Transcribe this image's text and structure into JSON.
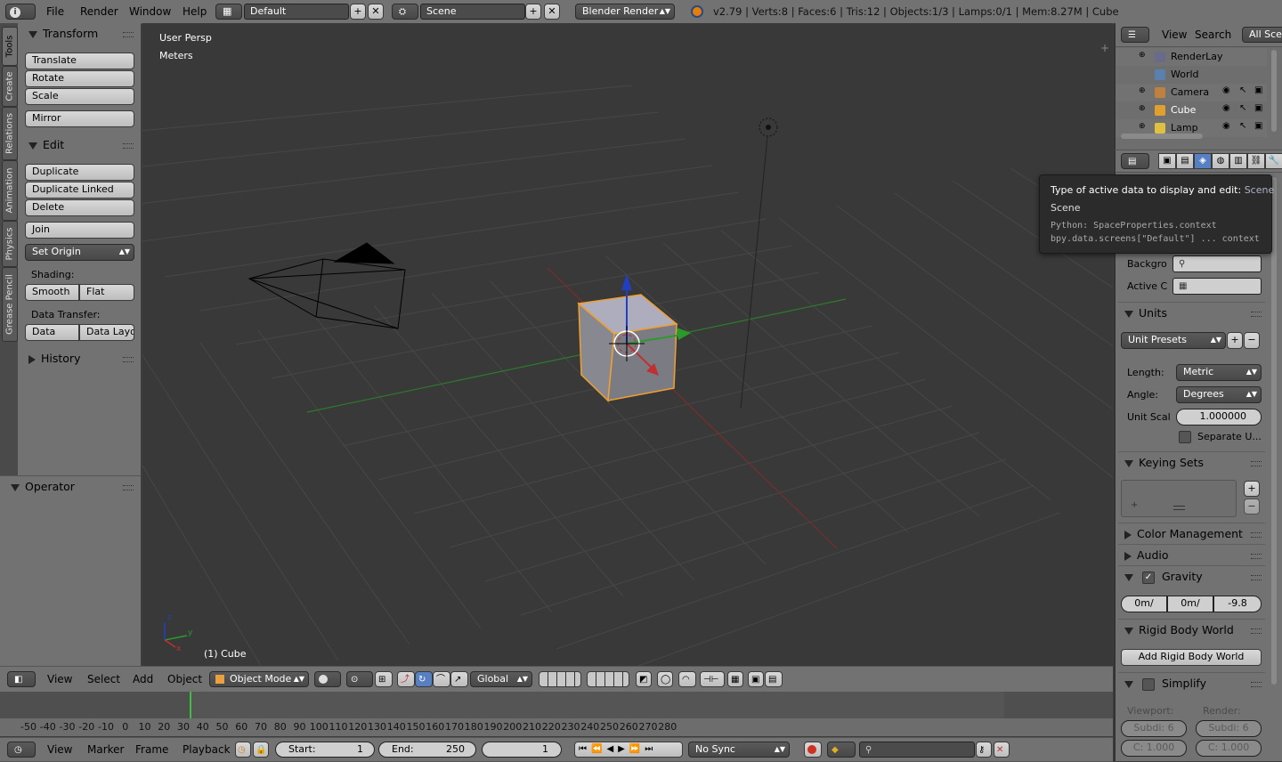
{
  "top_header": {
    "menus": [
      "File",
      "Render",
      "Window",
      "Help"
    ],
    "layout": "Default",
    "scene": "Scene",
    "engine": "Blender Render",
    "stats": "v2.79 | Verts:8 | Faces:6 | Tris:12 | Objects:1/3 | Lamps:0/1 | Mem:8.27M | Cube"
  },
  "tool_tabs": [
    "Tools",
    "Create",
    "Relations",
    "Animation",
    "Physics",
    "Grease Pencil"
  ],
  "tool_shelf": {
    "transform_title": "Transform",
    "translate": "Translate",
    "rotate": "Rotate",
    "scale": "Scale",
    "mirror": "Mirror",
    "edit_title": "Edit",
    "duplicate": "Duplicate",
    "duplicate_linked": "Duplicate Linked",
    "delete": "Delete",
    "join": "Join",
    "set_origin": "Set Origin",
    "shading_label": "Shading:",
    "smooth": "Smooth",
    "flat": "Flat",
    "data_transfer_label": "Data Transfer:",
    "data": "Data",
    "data_layo": "Data Layo",
    "history_title": "History",
    "operator_title": "Operator"
  },
  "viewport": {
    "view_name": "User Persp",
    "units": "Meters",
    "object_label": "(1) Cube",
    "axis_x": "x",
    "axis_y": "y",
    "axis_z": "z"
  },
  "view3d_header": {
    "view": "View",
    "select": "Select",
    "add": "Add",
    "object": "Object",
    "mode": "Object Mode",
    "orientation": "Global"
  },
  "timeline": {
    "ticks": [
      "-50",
      "-40",
      "-30",
      "-20",
      "-10",
      "0",
      "10",
      "20",
      "30",
      "40",
      "50",
      "60",
      "70",
      "80",
      "90",
      "100",
      "110",
      "120",
      "130",
      "140",
      "150",
      "160",
      "170",
      "180",
      "190",
      "200",
      "210",
      "220",
      "230",
      "240",
      "250",
      "260",
      "270",
      "280"
    ],
    "menus": [
      "View",
      "Marker",
      "Frame",
      "Playback"
    ],
    "start_label": "Start:",
    "start_value": "1",
    "end_label": "End:",
    "end_value": "250",
    "current_frame": "1",
    "sync": "No Sync"
  },
  "outliner": {
    "menus": [
      "View",
      "Search"
    ],
    "filter": "All Sce",
    "items": [
      "RenderLay",
      "World",
      "Camera",
      "Cube",
      "Lamp"
    ]
  },
  "tooltip": {
    "line1_prefix": "Type of active data to display and edit:",
    "line1_value": "Scene",
    "line2": "Scene",
    "python1": "Python: SpaceProperties.context",
    "python2": "bpy.data.screens[\"Default\"] ... context"
  },
  "properties": {
    "background_label": "Backgro",
    "active_clip_label": "Active C",
    "units_title": "Units",
    "unit_presets": "Unit Presets",
    "length_label": "Length:",
    "length_value": "Metric",
    "angle_label": "Angle:",
    "angle_value": "Degrees",
    "unit_scale_label": "Unit Scal",
    "unit_scale_value": "1.000000",
    "separate_units": "Separate U...",
    "keying_sets_title": "Keying Sets",
    "color_management_title": "Color Management",
    "audio_title": "Audio",
    "gravity_title": "Gravity",
    "gravity_x": "0m/",
    "gravity_y": "0m/",
    "gravity_z": "-9.8",
    "rigid_body_title": "Rigid Body World",
    "add_rigid_body": "Add Rigid Body World",
    "simplify_title": "Simplify",
    "viewport_label": "Viewport:",
    "render_label": "Render:",
    "subdiv_viewport": "Subdi: 6",
    "subdiv_render": "Subdi: 6",
    "child_viewport": "C: 1.000",
    "child_render": "C: 1.000"
  },
  "colors": {
    "viewport_bg": "#393939",
    "panel_bg": "#727272",
    "selection_outline": "#f0a030",
    "axis_red": "#c03030",
    "axis_green": "#2a9a2a",
    "axis_blue": "#2040c0"
  }
}
